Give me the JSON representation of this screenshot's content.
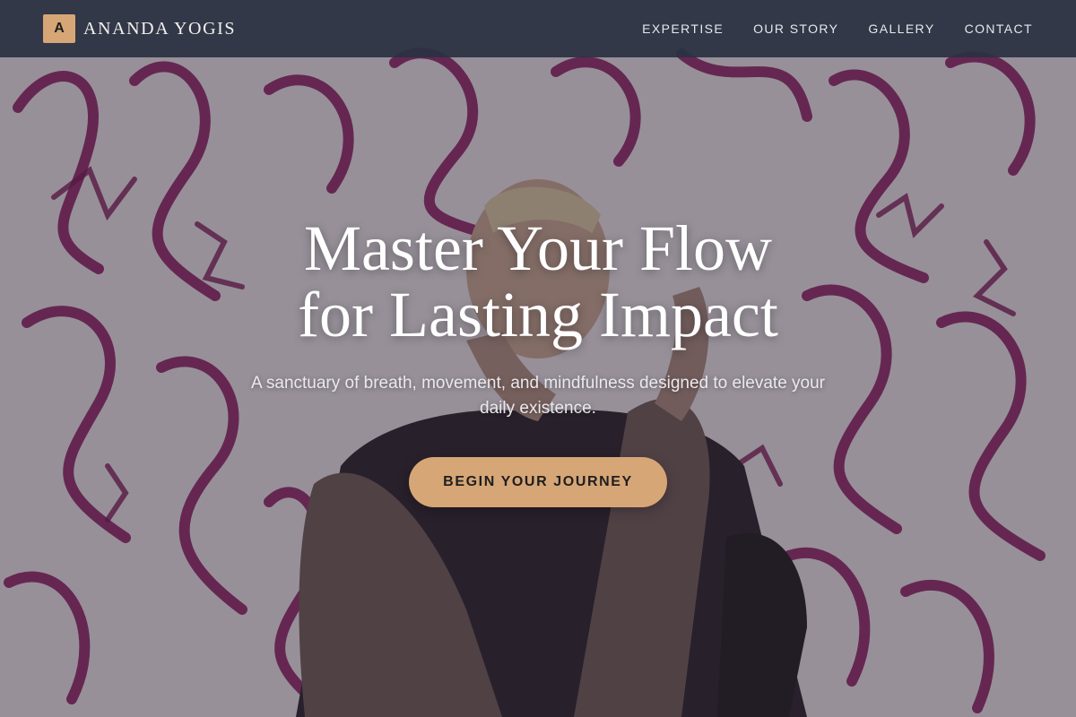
{
  "brand": {
    "initial": "A",
    "name": "ANANDA YOGIS"
  },
  "nav": {
    "items": [
      {
        "label": "EXPERTISE"
      },
      {
        "label": "OUR STORY"
      },
      {
        "label": "GALLERY"
      },
      {
        "label": "CONTACT"
      }
    ]
  },
  "hero": {
    "title_line1": "Master Your Flow",
    "title_line2": "for Lasting Impact",
    "subtitle": "A sanctuary of breath, movement, and mindfulness designed to elevate your daily existence.",
    "cta_label": "BEGIN YOUR JOURNEY",
    "background": "graffiti-wall-yoga-photo"
  },
  "colors": {
    "accent": "#d6a676",
    "nav_bg": "#2a3242",
    "graffiti": "#8a1a5e",
    "wall": "#e9e2e6"
  }
}
